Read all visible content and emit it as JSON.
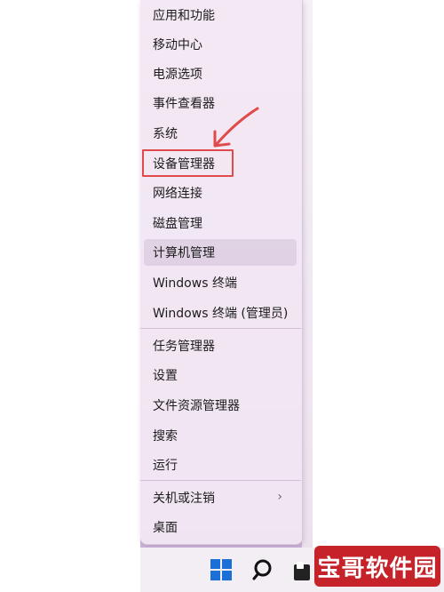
{
  "menu": {
    "items": [
      {
        "label": "应用和功能"
      },
      {
        "label": "移动中心"
      },
      {
        "label": "电源选项"
      },
      {
        "label": "事件查看器"
      },
      {
        "label": "系统"
      },
      {
        "label": "设备管理器"
      },
      {
        "label": "网络连接"
      },
      {
        "label": "磁盘管理"
      },
      {
        "label": "计算机管理"
      },
      {
        "label": "Windows 终端"
      },
      {
        "label": "Windows 终端 (管理员)"
      },
      {
        "label": "任务管理器"
      },
      {
        "label": "设置"
      },
      {
        "label": "文件资源管理器"
      },
      {
        "label": "搜索"
      },
      {
        "label": "运行"
      },
      {
        "label": "关机或注销"
      },
      {
        "label": "桌面"
      }
    ],
    "submenu_chevron": "›"
  },
  "watermark": {
    "text": "宝哥软件园"
  },
  "colors": {
    "highlight_box": "#e04a4a",
    "arrow": "#e04a4a",
    "watermark_bg": "#c6222a",
    "menu_bg": "#f3e8f4"
  },
  "icons": {
    "start": "windows-logo-icon",
    "search": "search-icon",
    "annotation": "red-arrow-icon"
  }
}
